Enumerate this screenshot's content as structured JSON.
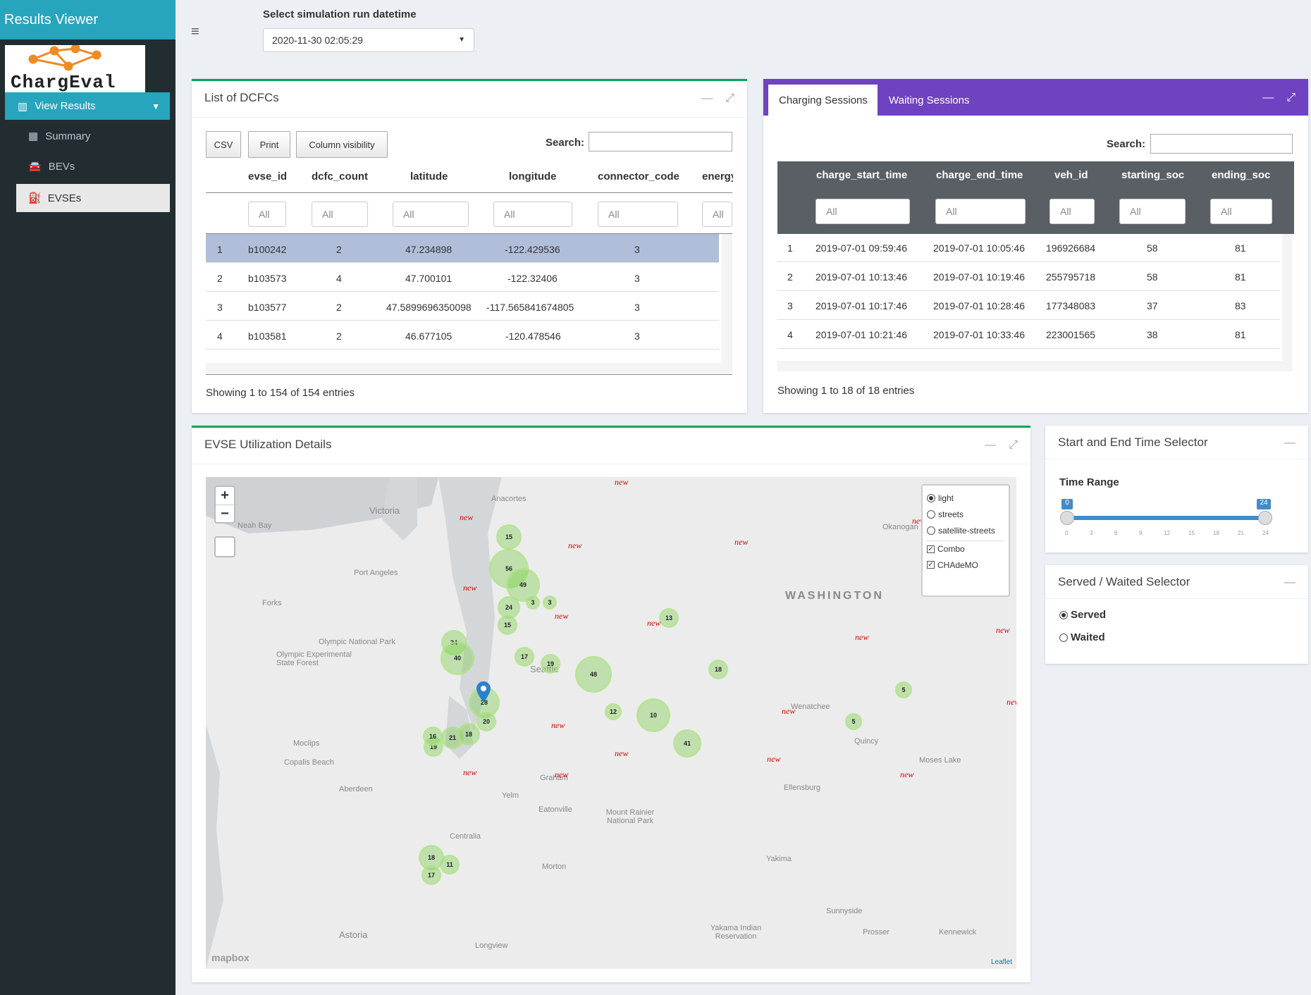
{
  "app": {
    "title": "Results Viewer",
    "logo_text": "ChargEval"
  },
  "sidebar": {
    "menu_label": "View Results",
    "items": [
      {
        "label": "Summary"
      },
      {
        "label": "BEVs"
      },
      {
        "label": "EVSEs"
      }
    ]
  },
  "run_selector": {
    "label": "Select simulation run datetime",
    "value": "2020-11-30 02:05:29"
  },
  "dcfc_box": {
    "title": "List of DCFCs",
    "buttons": [
      "CSV",
      "Print",
      "Column visibility"
    ],
    "search_label": "Search:",
    "columns": [
      "evse_id",
      "dcfc_count",
      "latitude",
      "longitude",
      "connector_code",
      "energy"
    ],
    "filter_placeholder": "All",
    "rows": [
      [
        "1",
        "b100242",
        "2",
        "47.234898",
        "-122.429536",
        "3"
      ],
      [
        "2",
        "b103573",
        "4",
        "47.700101",
        "-122.32406",
        "3"
      ],
      [
        "3",
        "b103577",
        "2",
        "47.5899696350098",
        "-117.565841674805",
        "3"
      ],
      [
        "4",
        "b103581",
        "2",
        "46.677105",
        "-120.478546",
        "3"
      ]
    ],
    "footer": "Showing 1 to 154 of 154 entries"
  },
  "sessions_box": {
    "tabs": [
      "Charging Sessions",
      "Waiting Sessions"
    ],
    "search_label": "Search:",
    "columns": [
      "charge_start_time",
      "charge_end_time",
      "veh_id",
      "starting_soc",
      "ending_soc"
    ],
    "filter_placeholder": "All",
    "rows": [
      [
        "1",
        "2019-07-01 09:59:46",
        "2019-07-01 10:05:46",
        "196926684",
        "58",
        "81"
      ],
      [
        "2",
        "2019-07-01 10:13:46",
        "2019-07-01 10:19:46",
        "255795718",
        "58",
        "81"
      ],
      [
        "3",
        "2019-07-01 10:17:46",
        "2019-07-01 10:28:46",
        "177348083",
        "37",
        "83"
      ],
      [
        "4",
        "2019-07-01 10:21:46",
        "2019-07-01 10:33:46",
        "223001565",
        "38",
        "81"
      ]
    ],
    "footer": "Showing 1 to 18 of 18 entries"
  },
  "map_box": {
    "title": "EVSE Utilization Details",
    "layers": [
      "light",
      "streets",
      "satellite-streets"
    ],
    "selected_layer": "light",
    "overlays": [
      "Combo",
      "CHAdeMO"
    ],
    "state_label": "WASHINGTON",
    "places": [
      "Victoria",
      "Port Angeles",
      "Forks",
      "Olympic National Park",
      "Olympic Experimental State Forest",
      "Moclips",
      "Copalis Beach",
      "Aberdeen",
      "Centralia",
      "Astoria",
      "Longview",
      "Graham",
      "Yelm",
      "Eatonville",
      "Mount Rainier National Park",
      "Morton",
      "Yakima",
      "Yakama Indian Reservation",
      "Sunnyside",
      "Prosser",
      "Kennewick",
      "Quincy",
      "Moses Lake",
      "Ellensburg",
      "Wenatchee",
      "Okanogan",
      "Anacortes",
      "Neah Bay",
      "Seattle"
    ],
    "clusters": [
      "15",
      "56",
      "49",
      "24",
      "15",
      "34",
      "40",
      "17",
      "19",
      "48",
      "12",
      "10",
      "41",
      "28",
      "21",
      "18",
      "20",
      "19",
      "16",
      "18",
      "17",
      "11",
      "13",
      "18",
      "5",
      "5",
      "3",
      "3"
    ],
    "new_label": "new",
    "attribution_left": "mapbox",
    "attribution_right": "Leaflet",
    "zoom_in": "+",
    "zoom_out": "−"
  },
  "time_box": {
    "title": "Start and End Time Selector",
    "label": "Time Range",
    "min_value": "0",
    "max_value": "24",
    "ticks": [
      "0",
      "3",
      "6",
      "9",
      "12",
      "15",
      "18",
      "21",
      "24"
    ],
    "range": [
      0,
      24
    ]
  },
  "served_box": {
    "title": "Served / Waited Selector",
    "options": [
      "Served",
      "Waited"
    ],
    "selected": "Served"
  },
  "colors": {
    "sidebar": "#222d32",
    "accent": "#27a5bd",
    "purple": "#6f42c1",
    "green": "#00a65a"
  }
}
